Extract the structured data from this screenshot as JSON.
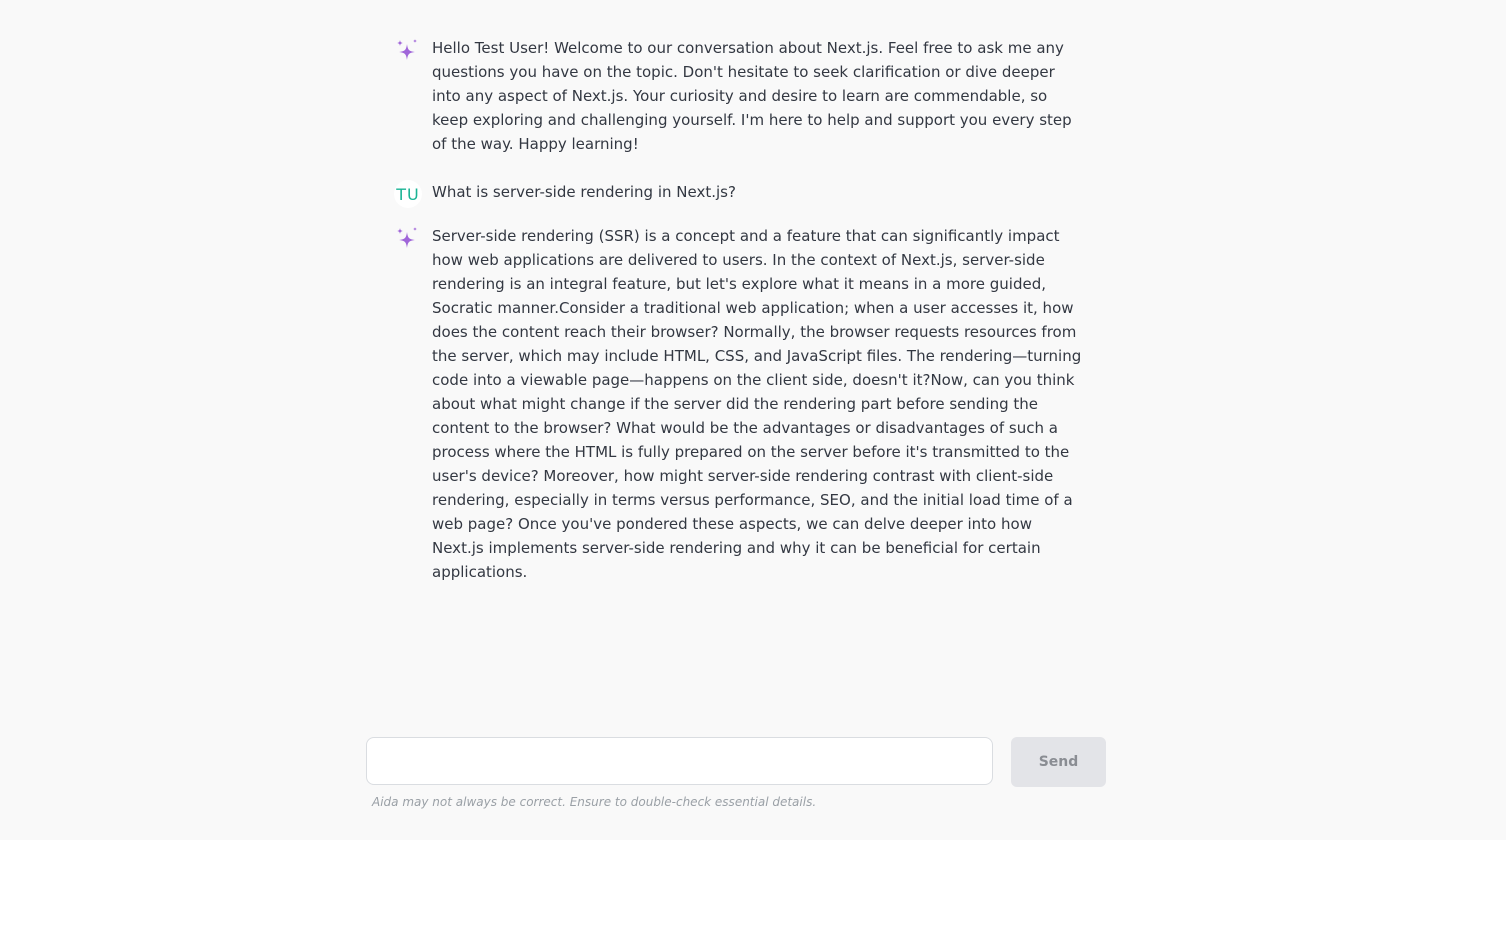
{
  "colors": {
    "page_bg": "#f9f9f9",
    "ai_icon": "#a066d9",
    "user_initials": "#1ab394",
    "send_bg": "#e3e4e8",
    "send_text": "#8a8d93"
  },
  "messages": [
    {
      "role": "assistant",
      "icon": "sparkle-icon",
      "text": "Hello Test User! Welcome to our conversation about Next.js. Feel free to ask me any questions you have on the topic. Don't hesitate to seek clarification or dive deeper into any aspect of Next.js. Your curiosity and desire to learn are commendable, so keep exploring and challenging yourself. I'm here to help and support you every step of the way. Happy learning!"
    },
    {
      "role": "user",
      "initials": "TU",
      "text": "What is server-side rendering in Next.js?"
    },
    {
      "role": "assistant",
      "icon": "sparkle-icon",
      "text": "Server-side rendering (SSR) is a concept and a feature that can significantly impact how web applications are delivered to users. In the context of Next.js, server-side rendering is an integral feature, but let's explore what it means in a more guided, Socratic manner.Consider a traditional web application; when a user accesses it, how does the content reach their browser? Normally, the browser requests resources from the server, which may include HTML, CSS, and JavaScript files. The rendering—turning code into a viewable page—happens on the client side, doesn't it?Now, can you think about what might change if the server did the rendering part before sending the content to the browser? What would be the advantages or disadvantages of such a process where the HTML is fully prepared on the server before it's transmitted to the user's device? Moreover, how might server-side rendering contrast with client-side rendering, especially in terms versus performance, SEO, and the initial load time of a web page? Once you've pondered these aspects, we can delve deeper into how Next.js implements server-side rendering and why it can be beneficial for certain applications."
    }
  ],
  "composer": {
    "input_value": "",
    "send_label": "Send",
    "disclaimer": "Aida may not always be correct. Ensure to double-check essential details."
  }
}
